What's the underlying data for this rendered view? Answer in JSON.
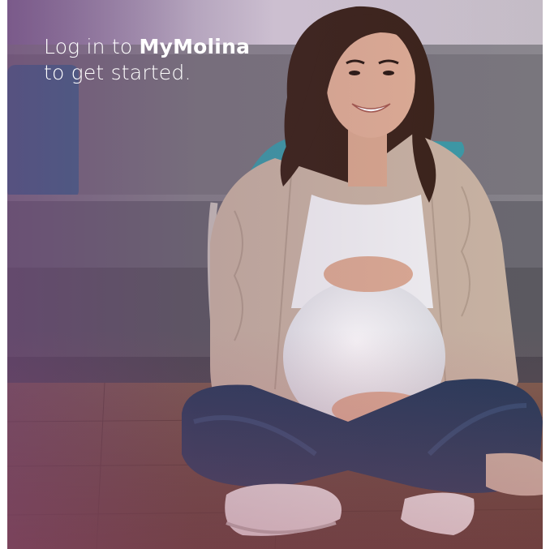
{
  "headline": {
    "line1_prefix": "Log in to ",
    "brand": "MyMolina",
    "line2": "to get started."
  },
  "photo": {
    "description_icon": "pregnant-woman-photo",
    "colors": {
      "wall": "#cfc6d0",
      "sofa": "#7d7b80",
      "pillow": "#3e6f8e",
      "floor": "#6b4a3a",
      "cardigan": "#c9b6a5",
      "shirt": "#f2f2f4",
      "jeans": "#223a5a",
      "hair": "#3b2418",
      "skin": "#d8a890"
    }
  }
}
